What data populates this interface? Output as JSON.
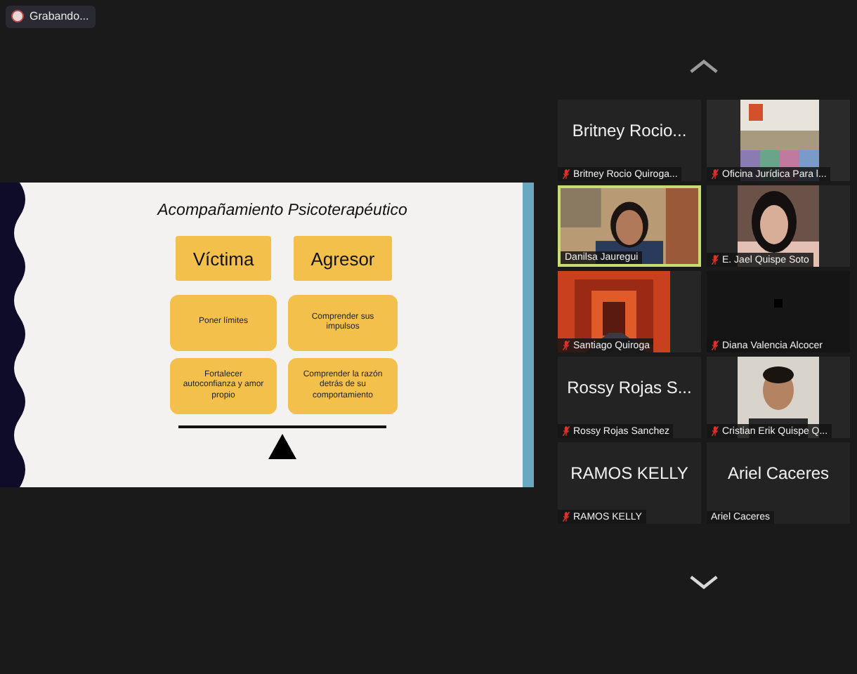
{
  "recording": {
    "label": "Grabando..."
  },
  "slide": {
    "title": "Acompañamiento Psicoterapéutico",
    "headers": [
      "Víctima",
      "Agresor"
    ],
    "cards": [
      "Poner límites",
      "Comprender sus impulsos",
      "Fortalecer autoconfianza y amor propio",
      "Comprender la razón detrás de su comportamiento"
    ]
  },
  "gallery": {
    "tiles": [
      {
        "kind": "name",
        "display": "Britney Rocio...",
        "label": "Britney Rocio Quiroga...",
        "muted": true,
        "selected": false
      },
      {
        "kind": "video",
        "label": "Oficina Jurídica Para l...",
        "muted": true,
        "selected": false
      },
      {
        "kind": "video",
        "label": "Danilsa Jauregui",
        "muted": false,
        "selected": true
      },
      {
        "kind": "video",
        "label": "E. Jael Quispe Soto",
        "muted": true,
        "selected": false
      },
      {
        "kind": "video",
        "label": "Santiago Quiroga",
        "muted": true,
        "selected": false
      },
      {
        "kind": "video",
        "label": "Diana Valencia Alcocer",
        "muted": true,
        "selected": false
      },
      {
        "kind": "name",
        "display": "Rossy Rojas S...",
        "label": "Rossy Rojas Sanchez",
        "muted": true,
        "selected": false
      },
      {
        "kind": "video",
        "label": "Cristian Erik Quispe Q...",
        "muted": true,
        "selected": false
      },
      {
        "kind": "name",
        "display": "RAMOS KELLY",
        "label": "RAMOS KELLY",
        "muted": true,
        "selected": false
      },
      {
        "kind": "name",
        "display": "Ariel Caceres",
        "label": "Ariel Caceres",
        "muted": false,
        "selected": false
      }
    ]
  }
}
